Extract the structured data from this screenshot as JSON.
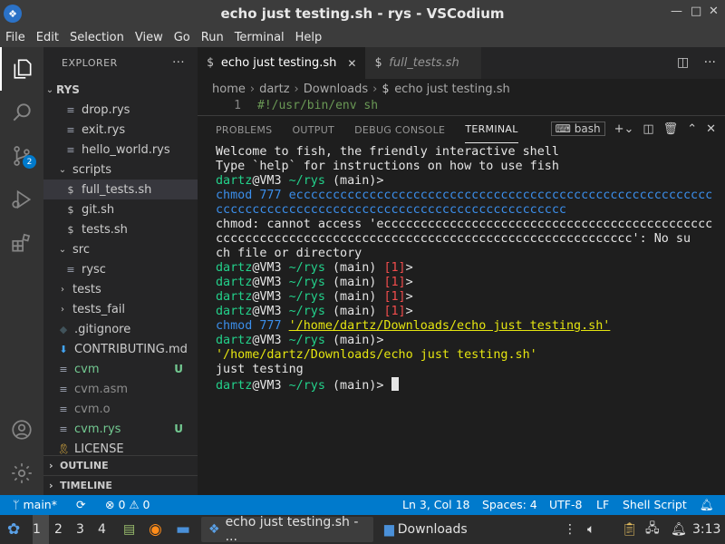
{
  "window": {
    "title": "echo just testing.sh - rys - VSCodium",
    "controls": [
      "—",
      "□",
      "✕"
    ]
  },
  "menu": [
    "File",
    "Edit",
    "Selection",
    "View",
    "Go",
    "Run",
    "Terminal",
    "Help"
  ],
  "activity": {
    "scm_badge": "2"
  },
  "explorer": {
    "header": "EXPLORER",
    "root": "RYS",
    "items": [
      {
        "label": "drop.rys",
        "icon": "file",
        "depth": 2
      },
      {
        "label": "exit.rys",
        "icon": "file",
        "depth": 2
      },
      {
        "label": "hello_world.rys",
        "icon": "file",
        "depth": 2
      },
      {
        "label": "scripts",
        "icon": "folder-open",
        "depth": 1
      },
      {
        "label": "full_tests.sh",
        "icon": "dollar",
        "depth": 2,
        "selected": true
      },
      {
        "label": "git.sh",
        "icon": "dollar",
        "depth": 2
      },
      {
        "label": "tests.sh",
        "icon": "dollar",
        "depth": 2
      },
      {
        "label": "src",
        "icon": "folder-open",
        "depth": 1
      },
      {
        "label": "rysc",
        "icon": "file",
        "depth": 2
      },
      {
        "label": "tests",
        "icon": "folder-closed",
        "depth": 1
      },
      {
        "label": "tests_fail",
        "icon": "folder-closed",
        "depth": 1
      },
      {
        "label": ".gitignore",
        "icon": "gitignore",
        "depth": 1
      },
      {
        "label": "CONTRIBUTING.md",
        "icon": "markdown",
        "depth": 1
      },
      {
        "label": "cvm",
        "icon": "file",
        "depth": 1,
        "git": "U",
        "color": "#73c991"
      },
      {
        "label": "cvm.asm",
        "icon": "file",
        "depth": 1,
        "color": "#8c8c8c"
      },
      {
        "label": "cvm.o",
        "icon": "file",
        "depth": 1,
        "color": "#8c8c8c"
      },
      {
        "label": "cvm.rys",
        "icon": "file",
        "depth": 1,
        "git": "U",
        "color": "#73c991"
      },
      {
        "label": "LICENSE",
        "icon": "license",
        "depth": 1
      }
    ],
    "outline": "OUTLINE",
    "timeline": "TIMELINE"
  },
  "tabs": [
    {
      "label": "echo just testing.sh",
      "active": true
    },
    {
      "label": "full_tests.sh",
      "active": false
    }
  ],
  "breadcrumb": [
    "home",
    "dartz",
    "Downloads",
    "echo just testing.sh"
  ],
  "editor": {
    "line_number": "1",
    "code": "#!/usr/bin/env sh"
  },
  "panel": {
    "tabs": [
      "PROBLEMS",
      "OUTPUT",
      "DEBUG CONSOLE",
      "TERMINAL"
    ],
    "active_tab": "TERMINAL",
    "shell": "bash"
  },
  "terminal": {
    "welcome1": "Welcome to fish, the friendly interactive shell",
    "welcome2": "Type `help` for instructions on how to use fish",
    "user": "dartz",
    "host": "@VM3",
    "cwd": "~/rys",
    "branch": "(main)>",
    "branch_open": "(main)",
    "status_code": "[1]",
    "chmod_cmd": "chmod",
    "chmod_mode": "777",
    "chmod_arg1": "eccccccccccccccccccccccccccccccccccccccccccccccccccccccccc",
    "chmod_arg2": "cccccccccccccccccccccccccccccccccccccccccccccccc",
    "err1": "chmod: cannot access 'eccccccccccccccccccccccccccccccccccccccccccccc",
    "err2": "ccccccccccccccccccccccccccccccccccccccccccccccccccccccccc': No su",
    "err3": "ch file or directory",
    "chmod_path": "'/home/dartz/Downloads/echo just testing.sh'",
    "quoted_cmd": "'/home/dartz/Downloads/echo just testing.sh'",
    "output": "just testing"
  },
  "status": {
    "branch": "main*",
    "problems": "⊗ 0 ⚠ 0",
    "position": "Ln 3, Col 18",
    "spaces": "Spaces: 4",
    "encoding": "UTF-8",
    "eol": "LF",
    "language": "Shell Script"
  },
  "taskbar": {
    "workspaces": [
      "1",
      "2",
      "3",
      "4"
    ],
    "task_vscodium": "echo just testing.sh - ...",
    "task_downloads": "Downloads",
    "clock": "3:13"
  }
}
